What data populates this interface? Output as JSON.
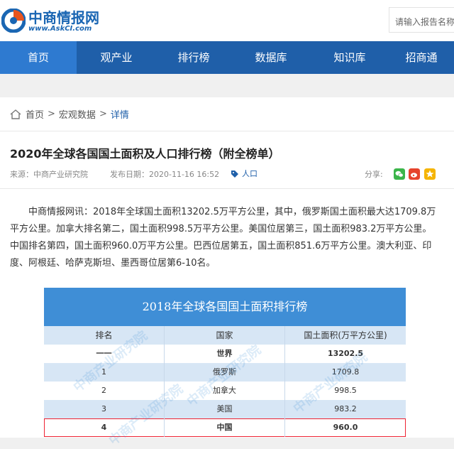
{
  "logo": {
    "cn": "中商情报网",
    "en": "www.AskCI.com"
  },
  "search": {
    "placeholder": "请输入报告名称"
  },
  "nav": [
    "首页",
    "观产业",
    "排行榜",
    "数据库",
    "知识库",
    "招商通"
  ],
  "breadcrumb": {
    "home": "首页",
    "sep": ">",
    "section": "宏观数据",
    "current": "详情"
  },
  "article": {
    "title": "2020年全球各国国土面积及人口排行榜（附全榜单）",
    "source_label": "来源：",
    "source": "中商产业研究院",
    "date_label": "发布日期：",
    "date": "2020-11-16 16:52",
    "tag": "人口",
    "share_label": "分享:",
    "body": "中商情报网讯：2018年全球国土面积13202.5万平方公里，其中，俄罗斯国土面积最大达1709.8万平方公里。加拿大排名第二，国土面积998.5万平方公里。美国位居第三，国土面积983.2万平方公里。中国排名第四，国土面积960.0万平方公里。巴西位居第五，国土面积851.6万平方公里。澳大利亚、印度、阿根廷、哈萨克斯坦、墨西哥位居第6-10名。"
  },
  "table": {
    "title": "2018年全球各国国土面积排行榜",
    "columns": [
      "排名",
      "国家",
      "国土面积(万平方公里)"
    ],
    "rows": [
      {
        "rank": "一一",
        "country": "世界",
        "area": "13202.5",
        "bold": true
      },
      {
        "rank": "1",
        "country": "俄罗斯",
        "area": "1709.8",
        "bold": false
      },
      {
        "rank": "2",
        "country": "加拿大",
        "area": "998.5",
        "bold": false
      },
      {
        "rank": "3",
        "country": "美国",
        "area": "983.2",
        "bold": false
      },
      {
        "rank": "4",
        "country": "中国",
        "area": "960.0",
        "bold": true
      }
    ],
    "watermark": "中商产业研究院"
  },
  "colors": {
    "nav": "#1f5fa9",
    "nav_active": "#2e7ad0",
    "table_head": "#3f8ed6",
    "row_alt": "#d7e6f5",
    "highlight": "#e23"
  }
}
